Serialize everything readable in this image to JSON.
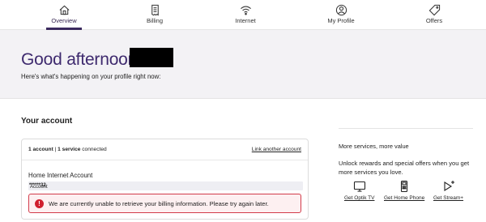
{
  "nav": {
    "items": [
      {
        "label": "Overview",
        "icon": "home-icon"
      },
      {
        "label": "Billing",
        "icon": "bill-icon"
      },
      {
        "label": "Internet",
        "icon": "wifi-icon"
      },
      {
        "label": "My Profile",
        "icon": "profile-icon"
      },
      {
        "label": "Offers",
        "icon": "tag-icon"
      }
    ],
    "active": "Overview"
  },
  "hero": {
    "greeting": "Good afternoon",
    "subtitle": "Here's what's happening on your profile right now:"
  },
  "account": {
    "section_title": "Your account",
    "count_accounts": "1 account",
    "count_services": "1 service",
    "count_suffix": "connected",
    "link_another": "Link another account",
    "account_title": "Home Internet Account",
    "account_label": "Account",
    "account_number": "******32",
    "alert_message": "We are currently unable to retrieve your billing information. Please try again later."
  },
  "more_services": {
    "title": "More services, more value",
    "description": "Unlock rewards and special offers when you get more services you love.",
    "items": [
      {
        "label": "Get Optik TV",
        "icon": "tv-icon"
      },
      {
        "label": "Get Home Phone",
        "icon": "home-phone-icon"
      },
      {
        "label": "Get Stream+",
        "icon": "stream-plus-icon"
      }
    ]
  },
  "colors": {
    "brand_purple": "#3e2a6e",
    "alert_red": "#d0202f",
    "hero_bg": "#f3f2f5"
  }
}
